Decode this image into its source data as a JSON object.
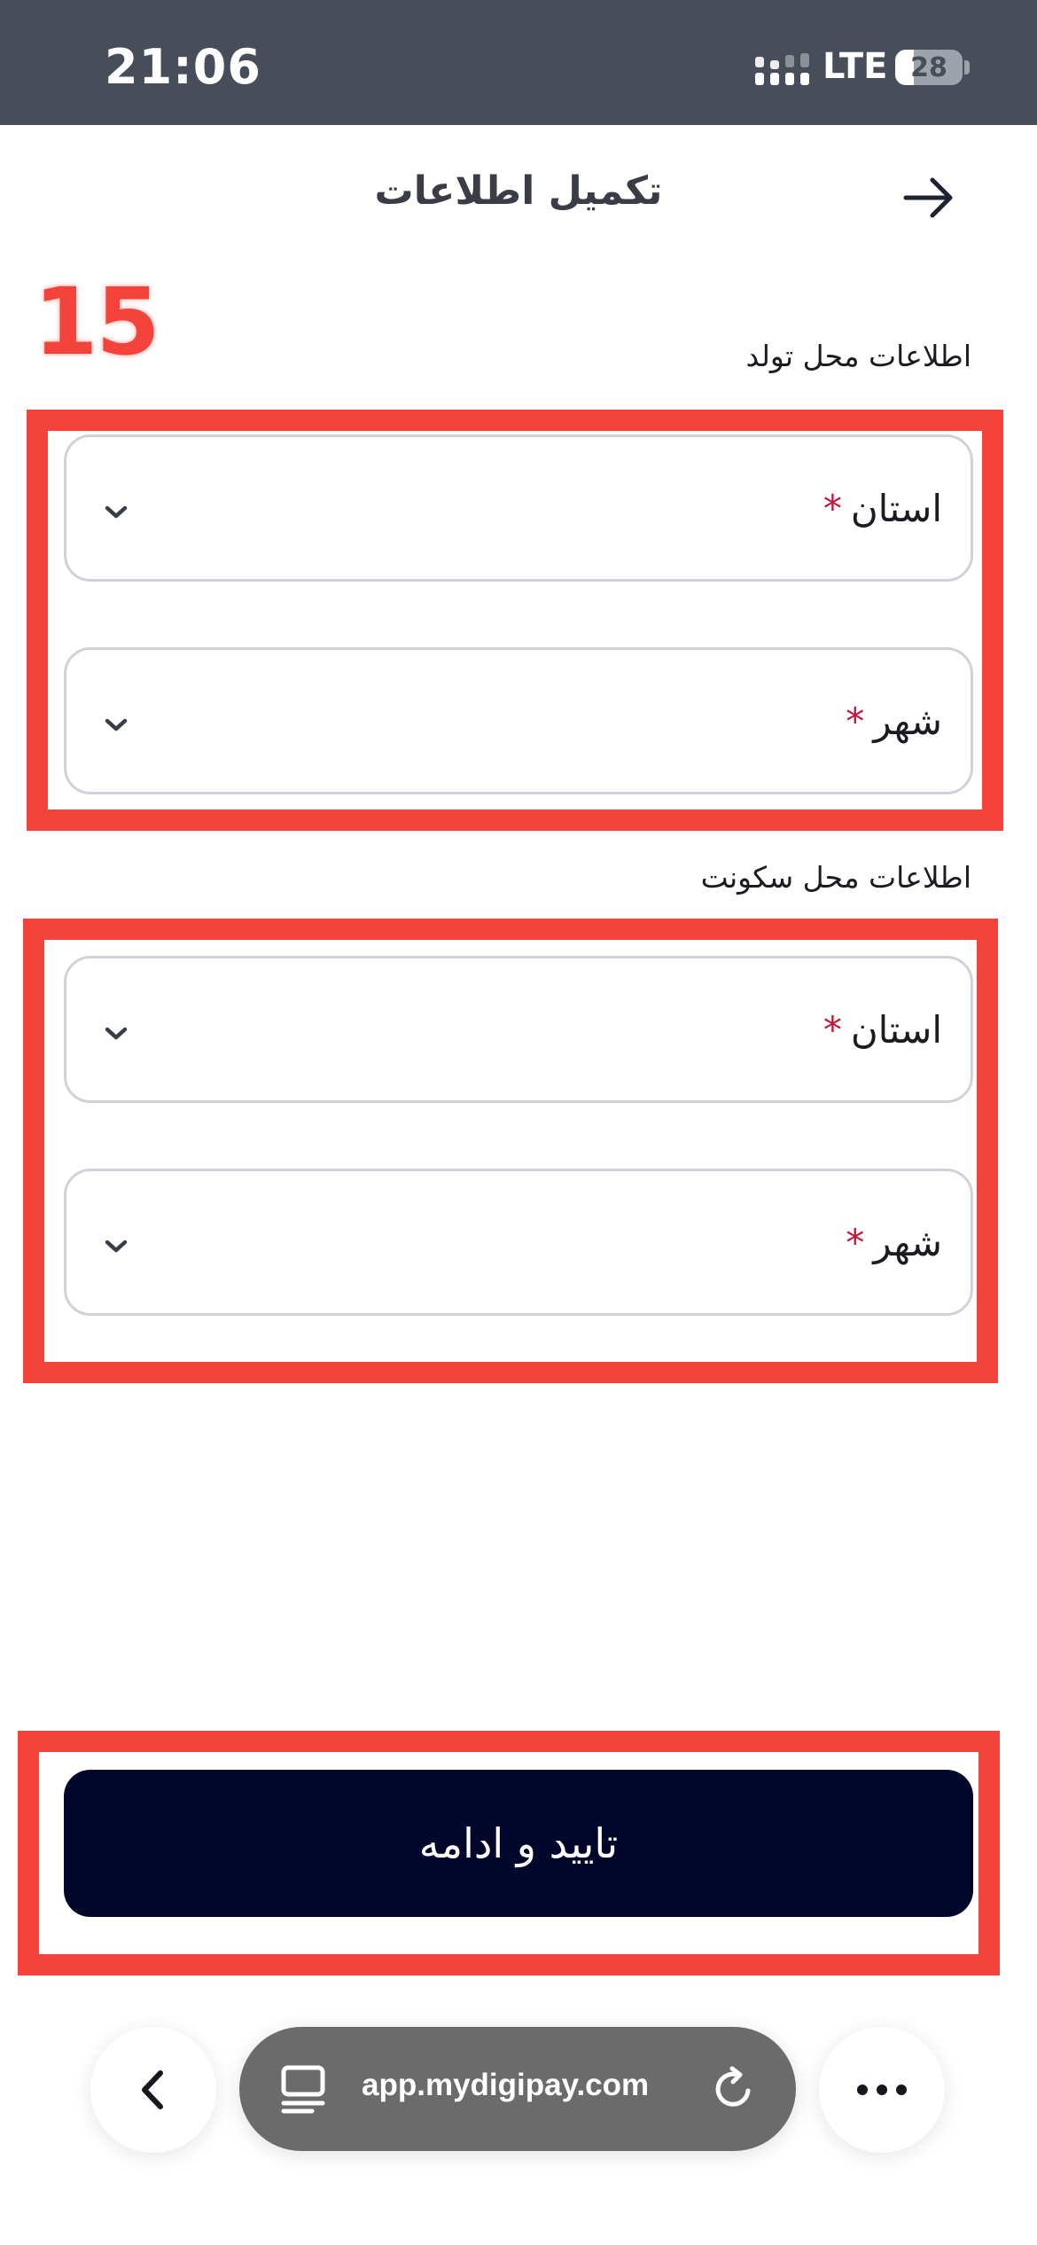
{
  "status_bar": {
    "time": "21:06",
    "network": "LTE",
    "battery": "28",
    "battery_level": 0.28
  },
  "header": {
    "title": "تکمیل اطلاعات",
    "back_icon": "arrow-right-icon"
  },
  "step_number": "15",
  "birth_section": {
    "label": "اطلاعات محل تولد",
    "province_label": "استان",
    "city_label": "شهر"
  },
  "residence_section": {
    "label": "اطلاعات محل سکونت",
    "province_label": "استان",
    "city_label": "شهر"
  },
  "required_mark": "*",
  "confirm_button": {
    "label": "تایید و ادامه"
  },
  "browser": {
    "url": "app.mydigipay.com"
  },
  "colors": {
    "accent": "#01062b",
    "highlight": "#f4433a",
    "required": "#c0183a",
    "status_bar": "#474e5a"
  }
}
